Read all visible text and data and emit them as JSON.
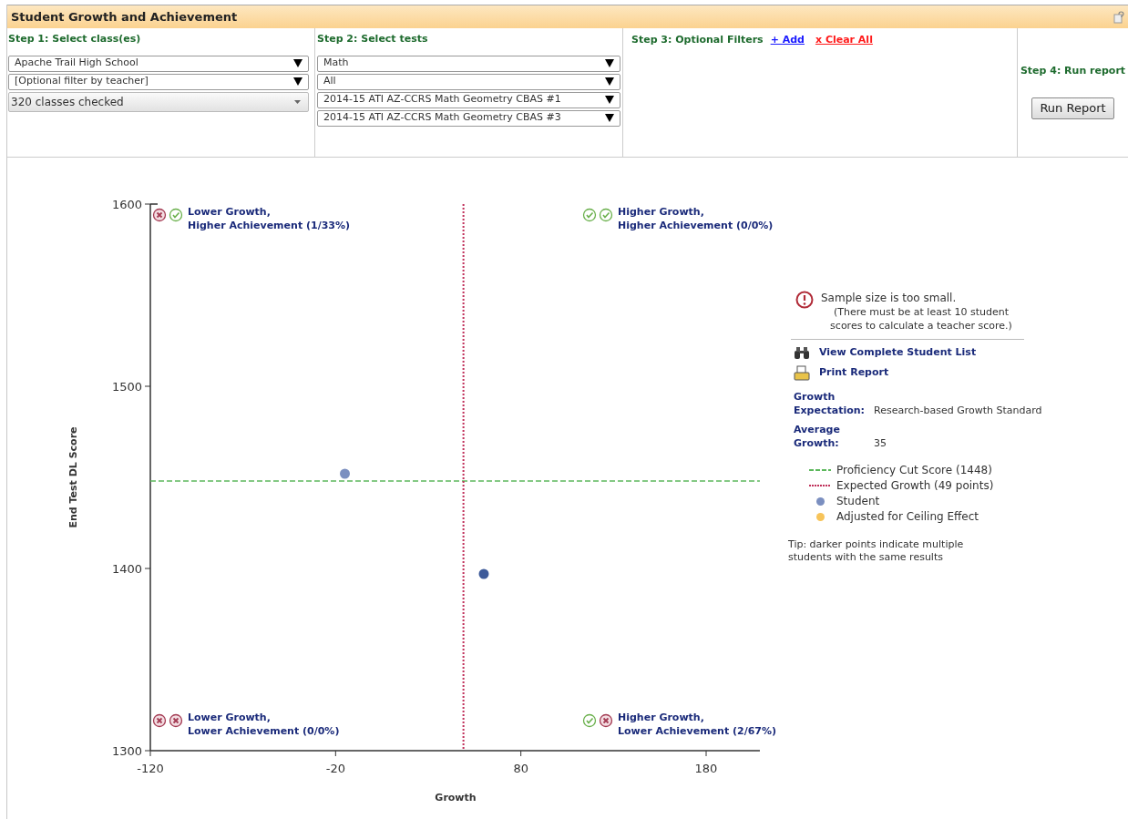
{
  "header": {
    "title": "Student Growth and Achievement"
  },
  "step1": {
    "label": "Step 1: Select class(es)",
    "selects": [
      {
        "value": "Apache Trail High School",
        "kind": "dropdown"
      },
      {
        "value": "[Optional filter by teacher]",
        "kind": "dropdown"
      },
      {
        "value": "320 classes checked",
        "kind": "multiselect"
      }
    ]
  },
  "step2": {
    "label": "Step 2: Select tests",
    "selects": [
      {
        "value": "Math",
        "kind": "dropdown"
      },
      {
        "value": "All",
        "kind": "dropdown"
      },
      {
        "value": "2014-15 ATI AZ-CCRS Math Geometry CBAS #1",
        "kind": "dropdown"
      },
      {
        "value": "2014-15 ATI AZ-CCRS Math Geometry CBAS #3",
        "kind": "dropdown"
      }
    ]
  },
  "step3": {
    "label": "Step 3: Optional Filters",
    "add_link": "+ Add",
    "clear_link": "x Clear All"
  },
  "step4": {
    "label": "Step 4: Run report",
    "button": "Run Report"
  },
  "chart": {
    "chart_data": {
      "type": "scatter",
      "xlabel": "Growth",
      "ylabel": "End Test DL Score",
      "xlim": [
        -120,
        209
      ],
      "ylim": [
        1300,
        1600
      ],
      "xticks": [
        -120,
        -20,
        80,
        180
      ],
      "yticks": [
        1300,
        1400,
        1500,
        1600
      ],
      "x": [
        -15,
        60
      ],
      "series": [
        {
          "name": "Student",
          "color": "#7b8fc0",
          "values": [
            1452,
            null
          ]
        },
        {
          "color": "#3d5a99",
          "values": [
            null,
            1397
          ]
        }
      ],
      "ref_lines": [
        {
          "axis": "y",
          "value": 1448,
          "color": "#5cb85c"
        },
        {
          "axis": "x",
          "value": 49,
          "color": "#c0305a"
        }
      ]
    },
    "quadrants": [
      {
        "line1": "Lower Growth,",
        "line2": "Higher Achievement (1/33%)",
        "growth_met": false,
        "achievement_met": true
      },
      {
        "line1": "Higher Growth,",
        "line2": "Higher Achievement (0/0%)",
        "growth_met": true,
        "achievement_met": true
      },
      {
        "line1": "Lower Growth,",
        "line2": "Lower Achievement (0/0%)",
        "growth_met": false,
        "achievement_met": false
      },
      {
        "line1": "Higher Growth,",
        "line2": "Lower Achievement (2/67%)",
        "growth_met": true,
        "achievement_met": false
      }
    ]
  },
  "side": {
    "warning": "Sample size is too small.",
    "warning_note": "(There must be at least 10 student scores to calculate a teacher score.)",
    "links": [
      {
        "label": "View Complete Student List",
        "kind": "binoculars"
      },
      {
        "label": "Print Report",
        "kind": "printer"
      }
    ],
    "facts": [
      {
        "label": "Growth Expectation:",
        "value": "Research-based Growth Standard"
      },
      {
        "label": "Average Growth:",
        "value": "35"
      }
    ],
    "legend": [
      {
        "label": "Proficiency Cut Score (1448)",
        "kind": "dashed",
        "color": "#5cb85c"
      },
      {
        "label": "Expected Growth (49 points)",
        "kind": "dotted",
        "color": "#c0305a"
      },
      {
        "kind": "series"
      },
      {
        "label": "Adjusted for Ceiling Effect",
        "kind": "dot",
        "color": "#f7c45a"
      }
    ],
    "tip": "Tip: darker points indicate multiple students with the same results"
  }
}
